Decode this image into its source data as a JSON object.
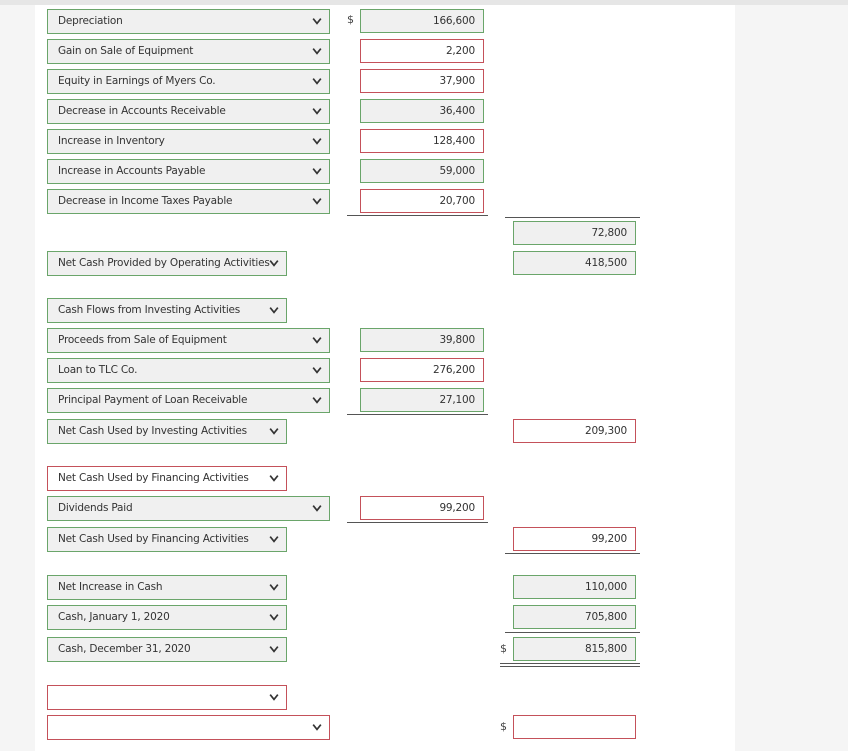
{
  "currency_symbol": "$",
  "operating": {
    "rows": [
      {
        "label": "Depreciation",
        "amount": "166,600"
      },
      {
        "label": "Gain on Sale of Equipment",
        "amount": "2,200"
      },
      {
        "label": "Equity in Earnings of Myers Co.",
        "amount": "37,900"
      },
      {
        "label": "Decrease in Accounts Receivable",
        "amount": "36,400"
      },
      {
        "label": "Increase in Inventory",
        "amount": "128,400"
      },
      {
        "label": "Increase in Accounts Payable",
        "amount": "59,000"
      },
      {
        "label": "Decrease in Income Taxes Payable",
        "amount": "20,700"
      }
    ],
    "adjustments_total": "72,800",
    "net_label": "Net Cash Provided by Operating Activities",
    "net_total": "418,500"
  },
  "investing": {
    "header_label": "Cash Flows from Investing Activities",
    "rows": [
      {
        "label": "Proceeds from Sale of Equipment",
        "amount": "39,800"
      },
      {
        "label": "Loan to TLC Co.",
        "amount": "276,200"
      },
      {
        "label": "Principal Payment of Loan Receivable",
        "amount": "27,100"
      }
    ],
    "net_label": "Net Cash Used by Investing Activities",
    "net_total": "209,300"
  },
  "financing": {
    "header_label": "Net Cash Used by Financing Activities",
    "rows": [
      {
        "label": "Dividends Paid",
        "amount": "99,200"
      }
    ],
    "net_label": "Net Cash Used by Financing Activities",
    "net_total": "99,200"
  },
  "summary": {
    "net_increase_label": "Net Increase in Cash",
    "net_increase": "110,000",
    "beginning_label": "Cash, January 1, 2020",
    "beginning": "705,800",
    "ending_label": "Cash, December 31, 2020",
    "ending": "815,800"
  },
  "blank": {
    "row1_label": "",
    "row2_label": "",
    "row2_amount": ""
  }
}
